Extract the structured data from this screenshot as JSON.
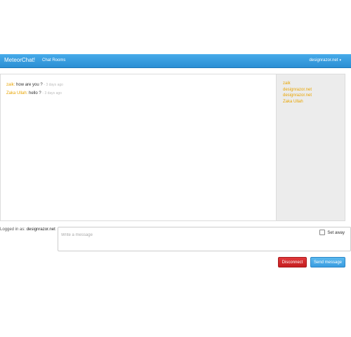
{
  "navbar": {
    "brand": "MeteorChat!",
    "link_chat_rooms": "Chat Rooms",
    "user_menu": "designrazor.net",
    "caret": "▾"
  },
  "messages": [
    {
      "user": "zaik:",
      "text": "how are you ?",
      "time": "- 3 days ago"
    },
    {
      "user": "Zaka Ullah:",
      "text": "hello ?",
      "time": "- 3 days ago"
    }
  ],
  "users": [
    "zaik",
    "designrazor.net",
    "designrazor.net",
    "Zaka Ullah"
  ],
  "login": {
    "prefix": "Logged in as:",
    "username": "designrazor.net"
  },
  "compose": {
    "placeholder": "Write a message",
    "value": "",
    "away_label": "Set away",
    "away_checked": false
  },
  "buttons": {
    "disconnect": "Disconnect",
    "send": "Send message"
  },
  "colors": {
    "navbar": "#2b8fd4",
    "username_accent": "#e8a400",
    "disconnect": "#c41e20",
    "send": "#3a9ce0"
  }
}
